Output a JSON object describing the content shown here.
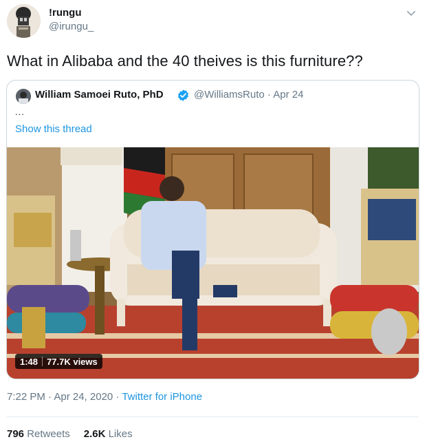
{
  "author": {
    "name": "!rungu",
    "handle": "@irungu_"
  },
  "tweet": {
    "text": "What in Alibaba and the 40 theives is this furniture??"
  },
  "quoted": {
    "name": "William Samoei Ruto, PhD",
    "handle_date": "@WilliamsRuto · Apr 24",
    "ellipsis": "...",
    "show_thread": "Show this thread",
    "video": {
      "duration": "1:48",
      "views": "77.7K views"
    }
  },
  "meta": {
    "time_date": "7:22 PM · Apr 24, 2020 · ",
    "source": "Twitter for iPhone"
  },
  "stats": {
    "retweets_count": "796",
    "retweets_label": "Retweets",
    "likes_count": "2.6K",
    "likes_label": "Likes"
  },
  "icons": {
    "menu": "chevron-down-icon",
    "verified": "verified-badge-icon"
  },
  "colors": {
    "link": "#1b95e0",
    "secondary_text": "#657786",
    "verified": "#1da1f2"
  }
}
